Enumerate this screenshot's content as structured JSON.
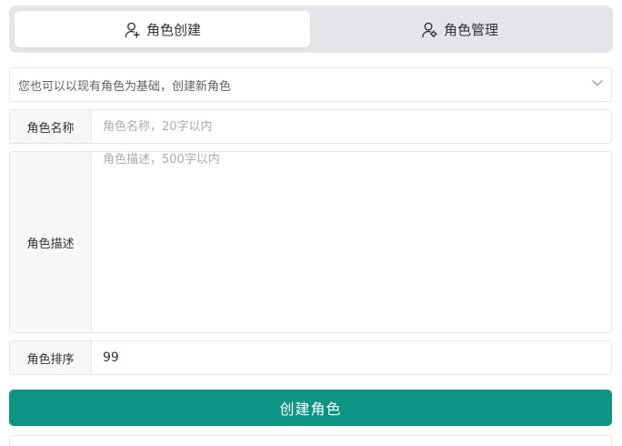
{
  "tabs": [
    {
      "label": "角色创建",
      "icon": "user-add-icon",
      "active": true
    },
    {
      "label": "角色管理",
      "icon": "user-settings-icon",
      "active": false
    }
  ],
  "base_role_select": {
    "placeholder": "您也可以以现有角色为基础，创建新角色",
    "icon": "chevron-down-icon"
  },
  "form": {
    "name": {
      "label": "角色名称",
      "placeholder": "角色名称，20字以内",
      "value": ""
    },
    "description": {
      "label": "角色描述",
      "placeholder": "角色描述，500字以内",
      "value": ""
    },
    "sort": {
      "label": "角色排序",
      "value": "99"
    }
  },
  "submit_label": "创建角色",
  "colors": {
    "primary": "#0e9484",
    "tab_track": "#e4e5e8",
    "label_bg": "#f7f7f8",
    "border": "#e4e7ed"
  }
}
